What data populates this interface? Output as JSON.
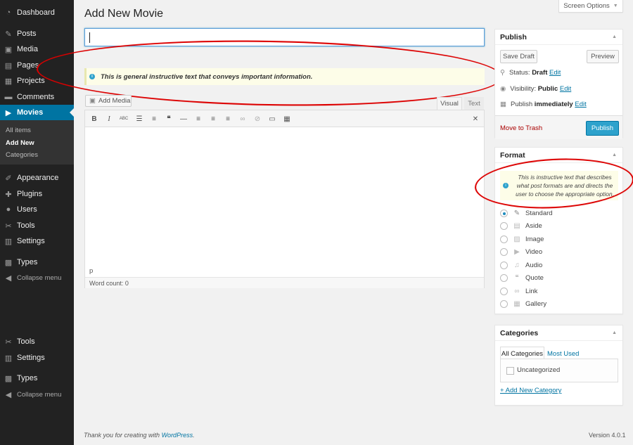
{
  "sidebar": {
    "items": [
      {
        "label": "Dashboard",
        "icon": "dashboard-icon"
      },
      {
        "label": "Posts",
        "icon": "pin-icon"
      },
      {
        "label": "Media",
        "icon": "media-icon"
      },
      {
        "label": "Pages",
        "icon": "pages-icon"
      },
      {
        "label": "Projects",
        "icon": "portfolio-icon"
      },
      {
        "label": "Comments",
        "icon": "comment-icon"
      },
      {
        "label": "Movies",
        "icon": "video-icon"
      },
      {
        "label": "Appearance",
        "icon": "brush-icon"
      },
      {
        "label": "Plugins",
        "icon": "plugin-icon"
      },
      {
        "label": "Users",
        "icon": "users-icon"
      },
      {
        "label": "Tools",
        "icon": "wrench-icon"
      },
      {
        "label": "Settings",
        "icon": "settings-icon"
      },
      {
        "label": "Types",
        "icon": "calendar-icon"
      },
      {
        "label": "Collapse menu",
        "icon": "collapse-icon"
      }
    ],
    "submenu": [
      "All items",
      "Add New",
      "Categories"
    ],
    "lower_items": [
      {
        "label": "Tools",
        "icon": "wrench-icon"
      },
      {
        "label": "Settings",
        "icon": "settings-icon"
      },
      {
        "label": "Types",
        "icon": "calendar-icon"
      },
      {
        "label": "Collapse menu",
        "icon": "collapse-icon"
      }
    ]
  },
  "header": {
    "title": "Add New Movie",
    "screen_options": "Screen Options"
  },
  "notice": {
    "text": "This is general instructive text that conveys important information."
  },
  "editor": {
    "add_media": "Add Media",
    "tab_visual": "Visual",
    "tab_text": "Text",
    "toolbar_icons": [
      "bold-icon",
      "italic-icon",
      "strikethrough-icon",
      "bullet-list-icon",
      "numbered-list-icon",
      "blockquote-icon",
      "horizontal-rule-icon",
      "align-left-icon",
      "align-center-icon",
      "align-right-icon",
      "link-icon",
      "unlink-icon",
      "read-more-icon",
      "toolbar-toggle-icon",
      "fullscreen-icon"
    ],
    "path": "p",
    "word_count": "Word count: 0"
  },
  "publish": {
    "title": "Publish",
    "save_draft": "Save Draft",
    "preview": "Preview",
    "status_label": "Status:",
    "status_value": "Draft",
    "visibility_label": "Visibility:",
    "visibility_value": "Public",
    "publish_label": "Publish",
    "publish_value": "immediately",
    "edit": "Edit",
    "move_to_trash": "Move to Trash",
    "publish_button": "Publish"
  },
  "format": {
    "title": "Format",
    "notice": "This is instructive text that describes what post formats are and directs the user to choose the appropriate option.",
    "options": [
      {
        "label": "Standard",
        "icon": "pin-icon",
        "checked": true
      },
      {
        "label": "Aside",
        "icon": "aside-icon",
        "checked": false
      },
      {
        "label": "Image",
        "icon": "image-icon",
        "checked": false
      },
      {
        "label": "Video",
        "icon": "video-icon",
        "checked": false
      },
      {
        "label": "Audio",
        "icon": "audio-icon",
        "checked": false
      },
      {
        "label": "Quote",
        "icon": "quote-icon",
        "checked": false
      },
      {
        "label": "Link",
        "icon": "link-icon",
        "checked": false
      },
      {
        "label": "Gallery",
        "icon": "gallery-icon",
        "checked": false
      }
    ]
  },
  "categories": {
    "title": "Categories",
    "tab_all": "All Categories",
    "tab_most": "Most Used",
    "items": [
      "Uncategorized"
    ],
    "add_new": "+ Add New Category"
  },
  "footer": {
    "thanks_prefix": "Thank you for creating with ",
    "thanks_link": "WordPress",
    "thanks_suffix": ".",
    "version": "Version 4.0.1"
  },
  "colors": {
    "sidebar_bg": "#222222",
    "active_menu": "#0074a2",
    "primary_button": "#2ea2cc",
    "notice_bg": "#fdfde8",
    "annotation": "#dd0000"
  }
}
